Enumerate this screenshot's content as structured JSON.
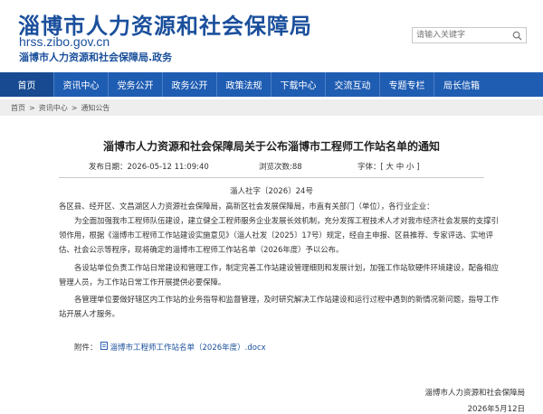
{
  "header": {
    "site_name": "淄博市人力资源和社会保障局",
    "domain": "hrss.zibo.gov.cn",
    "subtitle": "淄博市人力资源和社会保障局.政务",
    "search_placeholder": "请输入关键字",
    "search_icon": "magnifier-icon"
  },
  "nav": {
    "items": [
      "首页",
      "资讯中心",
      "党务公开",
      "政务公开",
      "政策法规",
      "下载中心",
      "交流互动",
      "专题专栏",
      "局长信箱"
    ]
  },
  "breadcrumb": {
    "items": [
      "首页",
      "资讯中心",
      "通知公告"
    ],
    "separator": ">"
  },
  "article": {
    "title": "淄博市人力资源和社会保障局关于公布淄博市工程师工作站名单的通知",
    "publish_date": "发布日期：2026-05-12 11:09:40",
    "views": "浏览次数:88",
    "font_size_label": "字体：[ 大 中 小 ]",
    "doc_number": "淄人社字〔2026〕24号",
    "recipients": "各区县、经开区、文昌湖区人力资源社会保障局，高新区社会发展保障局，市直有关部门（单位），各行业企业：",
    "paragraphs": [
      "为全面加强我市工程师队伍建设，建立健全工程师服务企业发展长效机制，充分发挥工程技术人才对我市经济社会发展的支撑引领作用，根据《淄博市工程师工作站建设实施意见》（淄人社发〔2025〕17号）规定，经自主申报、区县推荐、专家评选、实地评估、社会公示等程序，现将确定的淄博市工程师工作站名单（2026年度）予以公布。",
      "各设站单位负责工作站日常建设和管理工作，制定完善工作站建设管理细则和发展计划，加强工作站软硬件环境建设，配备相应管理人员，为工作站日常工作开展提供必要保障。",
      "各管理单位要做好辖区内工作站的业务指导和监督管理，及时研究解决工作站建设和运行过程中遇到的新情况新问题，指导工作站开展人才服务。"
    ],
    "attachment_label": "附件：",
    "attachment_name": "淄博市工程师工作站名单（2026年度）.docx",
    "attachment_icon": "document-icon",
    "signature_org": "淄博市人力资源和社会保障局",
    "signature_date": "2026年5月12日"
  },
  "colors": {
    "brand": "#1a4f9c",
    "nav_bg": "#1f5db3",
    "nav_active": "#174a91"
  }
}
